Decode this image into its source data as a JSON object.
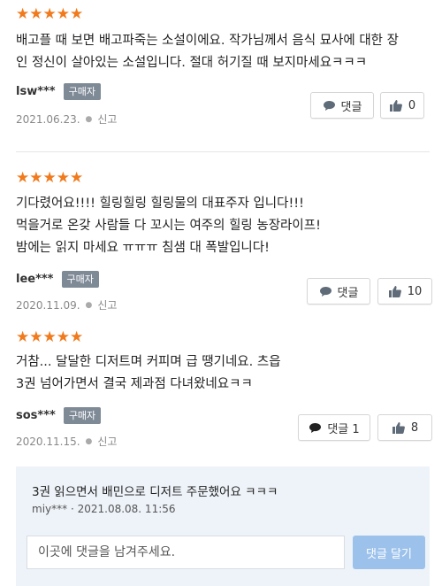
{
  "reviews": [
    {
      "rating": "★★★★★",
      "lines": [
        "배고플 때 보면 배고파죽는 소설이에요. 작가님께서 음식 묘사에 대한 장",
        "인 정신이 살아있는 소설입니다. 절대 허기질 때 보지마세요ㅋㅋㅋ"
      ],
      "user": "lsw***",
      "badge": "구매자",
      "date": "2021.06.23.",
      "report": "신고",
      "comment_label": "댓글",
      "like_count": "0"
    },
    {
      "rating": "★★★★★",
      "lines": [
        "기다렸어요!!!! 힐링힐링 힐링물의 대표주자 입니다!!!",
        "먹을거로 온갖 사람들 다 꼬시는 여주의 힐링 농장라이프!",
        "밤에는 읽지 마세요 ㅠㅠㅠ 침샘 대 폭발입니다!"
      ],
      "user": "lee***",
      "badge": "구매자",
      "date": "2020.11.09.",
      "report": "신고",
      "comment_label": "댓글",
      "like_count": "10"
    },
    {
      "rating": "★★★★★",
      "lines": [
        "거참... 달달한 디저트며 커피며 급 땡기네요. 츠읍",
        "3권 넘어가면서 결국 제과점 다녀왔네요ㅋㅋ"
      ],
      "user": "sos***",
      "badge": "구매자",
      "date": "2020.11.15.",
      "report": "신고",
      "comment_label": "댓글 1",
      "like_count": "8"
    }
  ],
  "reply": {
    "text": "3권 읽으면서 배민으로 디저트 주문했어요 ㅋㅋㅋ",
    "author": "miy***",
    "date": "2021.08.08. 11:56",
    "input_placeholder": "이곳에 댓글을 남겨주세요.",
    "submit_label": "댓글 달기"
  },
  "colors": {
    "star": "#f07a1c",
    "badge": "#7f8a97",
    "submit": "#9cc2ec",
    "reply_bg": "#eef3f9"
  },
  "icons": {
    "comment": "speech-bubble-icon",
    "like": "thumbs-up-icon"
  }
}
